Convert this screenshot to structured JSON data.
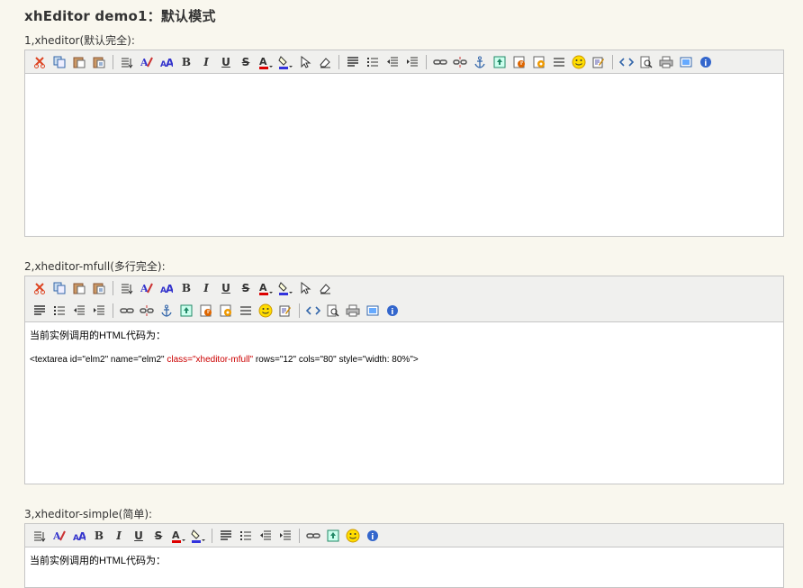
{
  "page_title": "xhEditor demo1：默认模式",
  "sections": [
    {
      "label": "1,xheditor(默认完全):"
    },
    {
      "label": "2,xheditor-mfull(多行完全):",
      "content_line1": "当前实例调用的HTML代码为：",
      "code_before": "<textarea id=\"elm2\" name=\"elm2\" ",
      "code_class": "class=\"xheditor-mfull\"",
      "code_after": " rows=\"12\" cols=\"80\" style=\"width: 80%\">"
    },
    {
      "label": "3,xheditor-simple(简单):",
      "content_line1": "当前实例调用的HTML代码为："
    }
  ],
  "colors": {
    "background": "#f9f7ee",
    "toolbar": "#f0f0ee",
    "border": "#c5c5c5",
    "class_text": "#cc0000"
  }
}
